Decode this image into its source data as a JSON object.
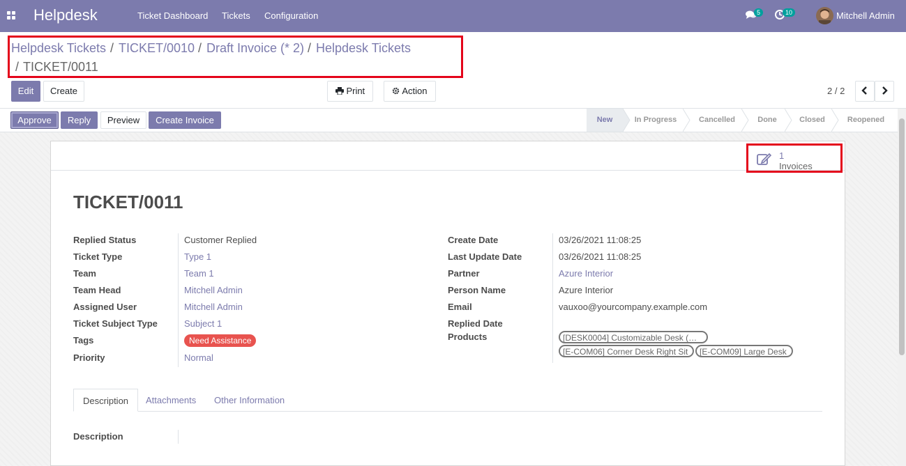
{
  "navbar": {
    "brand": "Helpdesk",
    "menu": [
      "Ticket Dashboard",
      "Tickets",
      "Configuration"
    ],
    "messages_count": "5",
    "activities_count": "10",
    "user_name": "Mitchell Admin"
  },
  "breadcrumb": {
    "items": [
      "Helpdesk Tickets",
      "TICKET/0010",
      "Draft Invoice (* 2)",
      "Helpdesk Tickets"
    ],
    "separator": "/",
    "active": "TICKET/0011"
  },
  "toolbar": {
    "edit": "Edit",
    "create": "Create",
    "print": "Print",
    "action": "Action",
    "pager": "2 / 2"
  },
  "statusbar": {
    "buttons": [
      "Approve",
      "Reply",
      "Preview",
      "Create Invoice"
    ],
    "stages": [
      "New",
      "In Progress",
      "Cancelled",
      "Done",
      "Closed",
      "Reopened"
    ],
    "active_stage": "New"
  },
  "smart_button": {
    "count": "1",
    "label": "Invoices"
  },
  "record": {
    "title": "TICKET/0011",
    "left_fields": [
      {
        "label": "Replied Status",
        "value": "Customer Replied"
      },
      {
        "label": "Ticket Type",
        "value": "Type 1"
      },
      {
        "label": "Team",
        "value": "Team 1"
      },
      {
        "label": "Team Head",
        "value": "Mitchell Admin"
      },
      {
        "label": "Assigned User",
        "value": "Mitchell Admin"
      },
      {
        "label": "Ticket Subject Type",
        "value": "Subject 1"
      },
      {
        "label": "Tags",
        "value": "Need Assistance"
      },
      {
        "label": "Priority",
        "value": "Normal"
      }
    ],
    "right_fields": [
      {
        "label": "Create Date",
        "value": "03/26/2021 11:08:25"
      },
      {
        "label": "Last Update Date",
        "value": "03/26/2021 11:08:25"
      },
      {
        "label": "Partner",
        "value": "Azure Interior"
      },
      {
        "label": "Person Name",
        "value": "Azure Interior"
      },
      {
        "label": "Email",
        "value": "vauxoo@yourcompany.example.com"
      },
      {
        "label": "Replied Date",
        "value": ""
      },
      {
        "label": "Products",
        "value": ""
      }
    ],
    "products": [
      "[DESK0004] Customizable Desk (…",
      "[E-COM06] Corner Desk Right Sit",
      "[E-COM09] Large Desk"
    ]
  },
  "tabs": [
    "Description",
    "Attachments",
    "Other Information"
  ],
  "description_label": "Description",
  "colors": {
    "primary": "#7c7bad",
    "highlight_border": "#e4051b",
    "tag_red": "#e8534f",
    "badge": "#00a09d"
  }
}
